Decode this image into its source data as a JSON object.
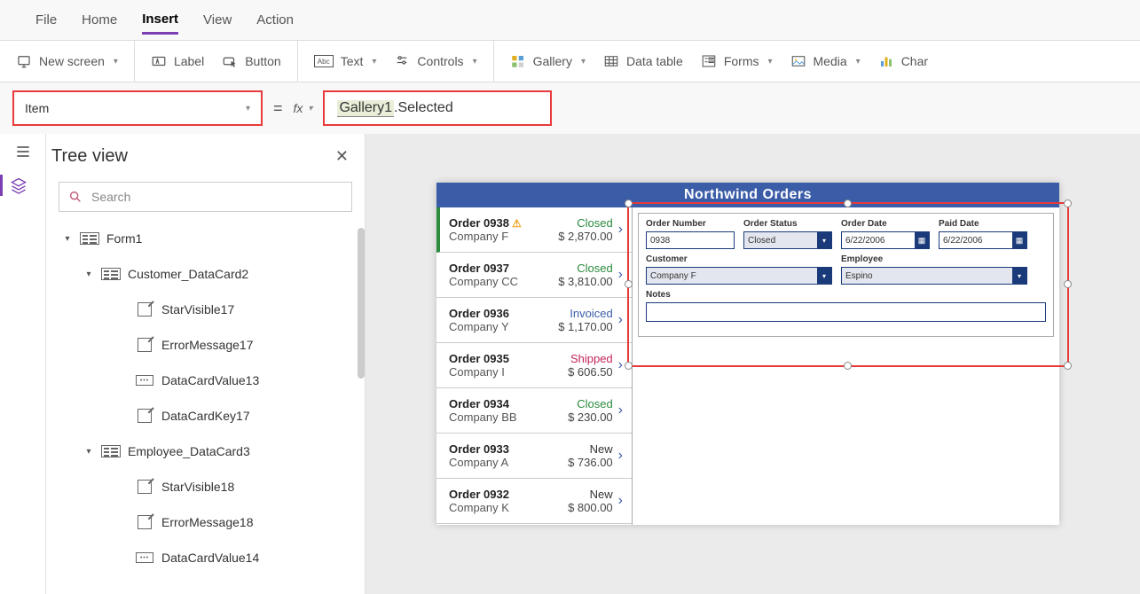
{
  "menu": {
    "items": [
      "File",
      "Home",
      "Insert",
      "View",
      "Action"
    ],
    "active": "Insert"
  },
  "ribbon": {
    "newScreen": "New screen",
    "label": "Label",
    "button": "Button",
    "text": "Text",
    "controls": "Controls",
    "gallery": "Gallery",
    "dataTable": "Data table",
    "forms": "Forms",
    "media": "Media",
    "chart": "Char"
  },
  "formula": {
    "property": "Item",
    "value_gallery": "Gallery1",
    "value_rest": ".Selected"
  },
  "tree": {
    "title": "Tree view",
    "searchPlaceholder": "Search",
    "nodes": [
      {
        "indent": 0,
        "caret": "▾",
        "type": "form",
        "label": "Form1"
      },
      {
        "indent": 1,
        "caret": "▾",
        "type": "form",
        "label": "Customer_DataCard2"
      },
      {
        "indent": 2,
        "caret": "",
        "type": "edit",
        "label": "StarVisible17"
      },
      {
        "indent": 2,
        "caret": "",
        "type": "edit",
        "label": "ErrorMessage17"
      },
      {
        "indent": 2,
        "caret": "",
        "type": "value",
        "label": "DataCardValue13"
      },
      {
        "indent": 2,
        "caret": "",
        "type": "edit",
        "label": "DataCardKey17"
      },
      {
        "indent": 1,
        "caret": "▾",
        "type": "form",
        "label": "Employee_DataCard3"
      },
      {
        "indent": 2,
        "caret": "",
        "type": "edit",
        "label": "StarVisible18"
      },
      {
        "indent": 2,
        "caret": "",
        "type": "edit",
        "label": "ErrorMessage18"
      },
      {
        "indent": 2,
        "caret": "",
        "type": "value",
        "label": "DataCardValue14"
      }
    ]
  },
  "app": {
    "title": "Northwind Orders",
    "gallery": [
      {
        "order": "Order 0938",
        "warn": true,
        "company": "Company F",
        "status": "Closed",
        "statusCls": "st-closed",
        "price": "$ 2,870.00",
        "selected": true
      },
      {
        "order": "Order 0937",
        "warn": false,
        "company": "Company CC",
        "status": "Closed",
        "statusCls": "st-closed",
        "price": "$ 3,810.00",
        "selected": false
      },
      {
        "order": "Order 0936",
        "warn": false,
        "company": "Company Y",
        "status": "Invoiced",
        "statusCls": "st-invoiced",
        "price": "$ 1,170.00",
        "selected": false
      },
      {
        "order": "Order 0935",
        "warn": false,
        "company": "Company I",
        "status": "Shipped",
        "statusCls": "st-shipped",
        "price": "$ 606.50",
        "selected": false
      },
      {
        "order": "Order 0934",
        "warn": false,
        "company": "Company BB",
        "status": "Closed",
        "statusCls": "st-closed",
        "price": "$ 230.00",
        "selected": false
      },
      {
        "order": "Order 0933",
        "warn": false,
        "company": "Company A",
        "status": "New",
        "statusCls": "st-new",
        "price": "$ 736.00",
        "selected": false
      },
      {
        "order": "Order 0932",
        "warn": false,
        "company": "Company K",
        "status": "New",
        "statusCls": "st-new",
        "price": "$ 800.00",
        "selected": false
      }
    ],
    "form": {
      "labels": {
        "orderNumber": "Order Number",
        "orderStatus": "Order Status",
        "orderDate": "Order Date",
        "paidDate": "Paid Date",
        "customer": "Customer",
        "employee": "Employee",
        "notes": "Notes"
      },
      "values": {
        "orderNumber": "0938",
        "orderStatus": "Closed",
        "orderDate": "6/22/2006",
        "paidDate": "6/22/2006",
        "customer": "Company F",
        "employee": "Espino",
        "notes": ""
      }
    }
  }
}
